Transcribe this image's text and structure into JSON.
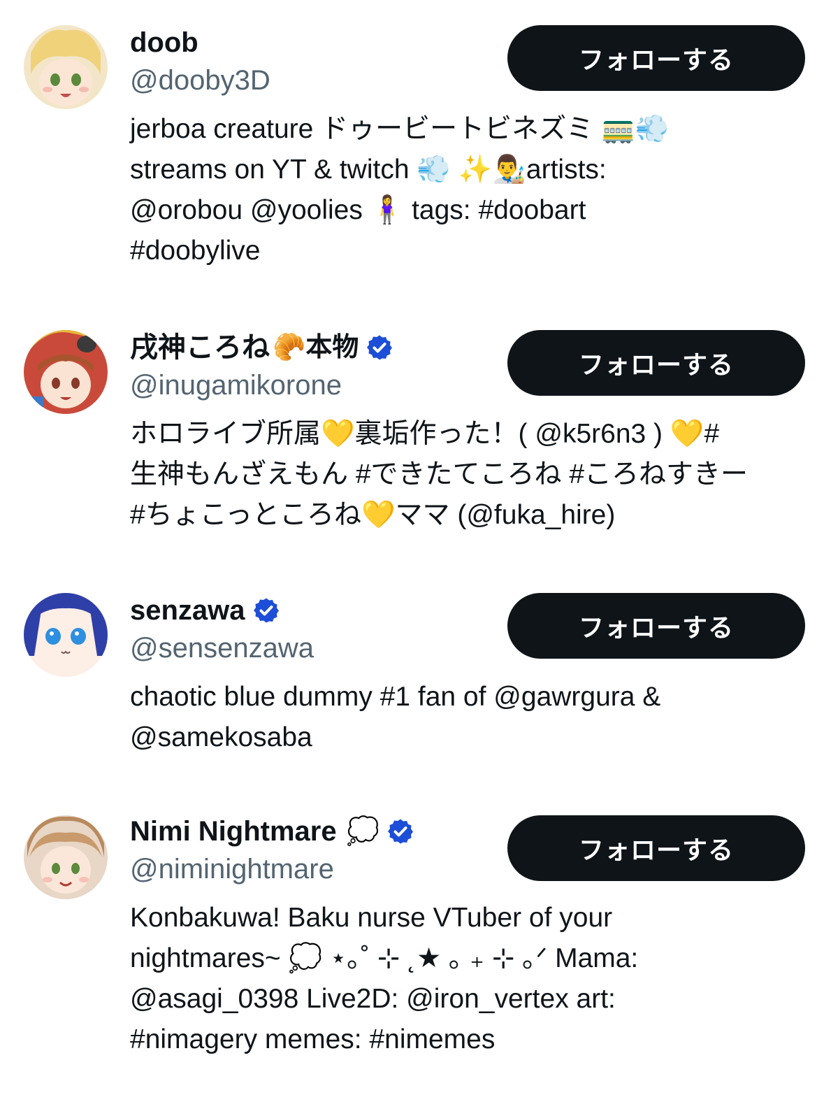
{
  "colors": {
    "text_primary": "#0f1419",
    "text_secondary": "#536471",
    "button_bg": "#0f1419",
    "button_text": "#ffffff",
    "verified_badge": "#1d4ed8"
  },
  "icons": {
    "verified": "verified-badge-icon"
  },
  "users": [
    {
      "display_name": "doob",
      "name_emoji": "",
      "verified": false,
      "handle": "@dooby3D",
      "follow_label": "フォローする",
      "bio": "jerboa creature ドゥービートビネズミ 🚃💨\nstreams on YT & twitch 💨 ✨👨‍🎨artists:\n@orobou @yoolies 🧍‍♀️ tags: #doobart\n#doobylive"
    },
    {
      "display_name": "戌神ころね",
      "name_emoji": "🥐本物",
      "verified": true,
      "handle": "@inugamikorone",
      "follow_label": "フォローする",
      "bio": "ホロライブ所属💛裏垢作った！( @k5r6n3 ) 💛#\n生神もんざえもん #できたてころね #ころねすきー\n#ちょこっところね💛ママ (@fuka_hire)"
    },
    {
      "display_name": "senzawa",
      "name_emoji": "",
      "verified": true,
      "handle": "@sensenzawa",
      "follow_label": "フォローする",
      "bio": "chaotic blue dummy #1 fan of @gawrgura &\n@samekosaba"
    },
    {
      "display_name": "Nimi Nightmare",
      "name_emoji": "💭",
      "verified": true,
      "handle": "@niminightmare",
      "follow_label": "フォローする",
      "bio": "Konbakuwa! Baku nurse VTuber of your\nnightmares~ 💭 ⋆｡˚ ⊹ ˛★ ｡ ₊ ⊹ ｡ᐟ Mama:\n@asagi_0398 Live2D: @iron_vertex art:\n#nimagery memes: #nimemes"
    }
  ]
}
